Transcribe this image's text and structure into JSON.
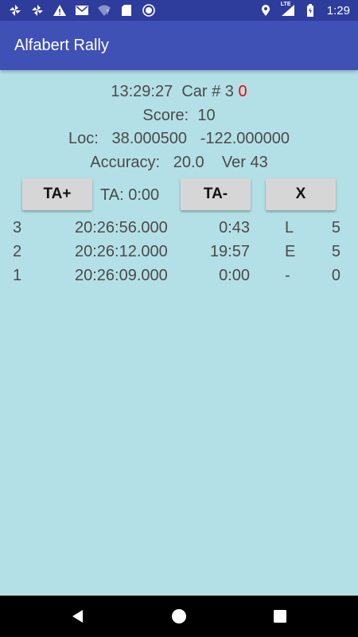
{
  "status_bar": {
    "time": "1:29",
    "lte_label": "LTE",
    "left_icons": [
      "pinwheel-icon",
      "pinwheel-icon",
      "warning-icon",
      "mail-icon",
      "wifi-question-icon",
      "sd-card-icon",
      "record-icon"
    ],
    "right_icons": [
      "location-icon",
      "signal-icon",
      "battery-icon"
    ],
    "background": "#2e3d9c"
  },
  "app_bar": {
    "title": "Alfabert Rally",
    "background": "#3f51b5"
  },
  "info": {
    "clock": "13:29:27",
    "car_label": "Car # 3",
    "car_zero": "0",
    "score_label": "Score:",
    "score_value": "10",
    "loc_label": "Loc:",
    "lat": "38.000500",
    "lon": "-122.000000",
    "accuracy_label": "Accuracy:",
    "accuracy_value": "20.0",
    "version": "Ver 43"
  },
  "controls": {
    "ta_plus": "TA+",
    "ta_label": "TA:",
    "ta_value": "0:00",
    "ta_minus": "TA-",
    "clear": "X"
  },
  "rows": [
    {
      "idx": "3",
      "time": "20:26:56.000",
      "dur": "0:43",
      "code": "L",
      "num": "5"
    },
    {
      "idx": "2",
      "time": "20:26:12.000",
      "dur": "19:57",
      "code": "E",
      "num": "5"
    },
    {
      "idx": "1",
      "time": "20:26:09.000",
      "dur": "0:00",
      "code": "-",
      "num": "0"
    }
  ],
  "colors": {
    "content_background": "#b3e0e6",
    "accent_red": "#ff0000",
    "button_grey": "#d6d6d6"
  },
  "nav_bar": {
    "icons": [
      "back-icon",
      "home-icon",
      "recents-icon"
    ]
  }
}
